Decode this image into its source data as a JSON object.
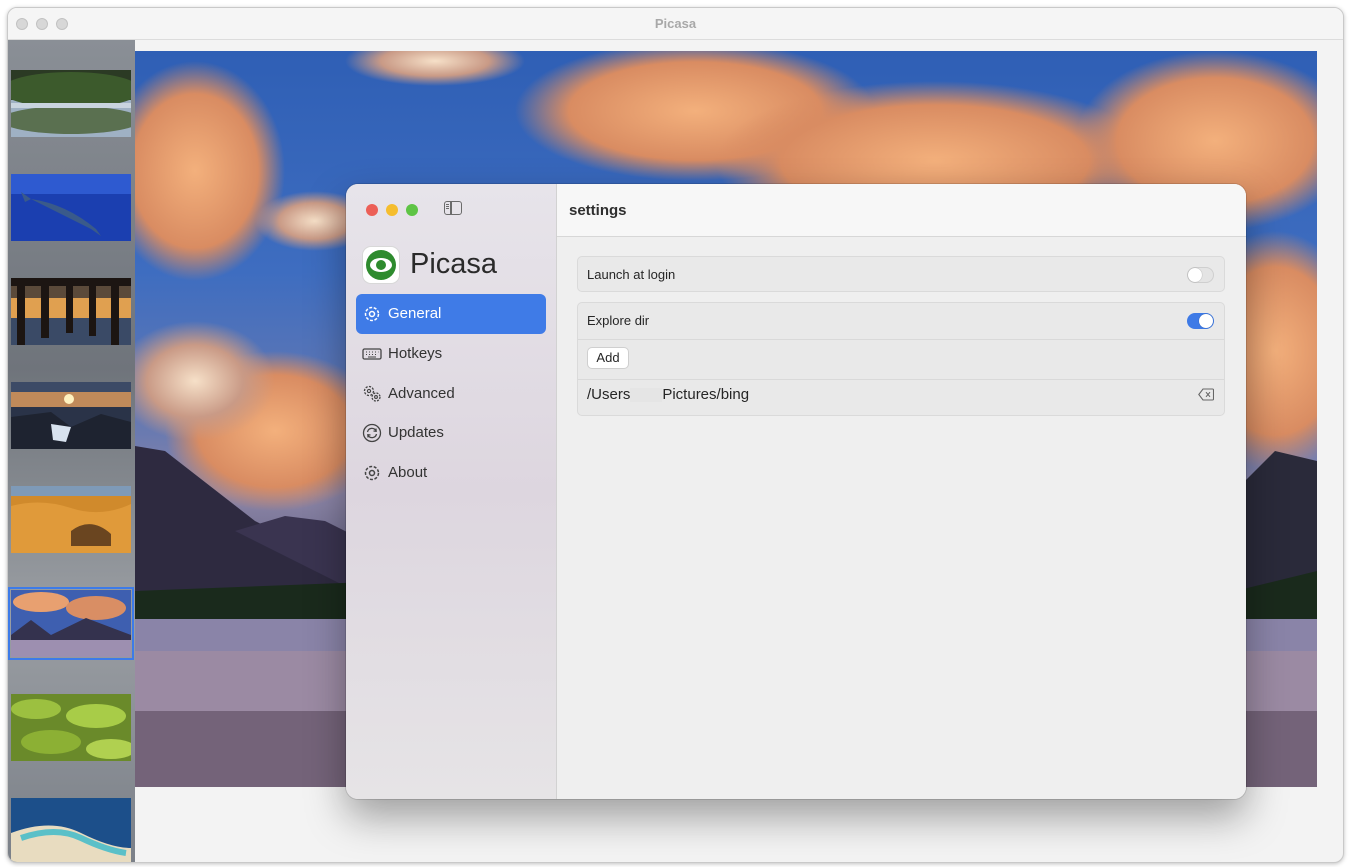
{
  "app": {
    "title": "Picasa"
  },
  "thumbnails": [
    {
      "name": "mangrove-reflection"
    },
    {
      "name": "whale-shark"
    },
    {
      "name": "pier-sunset"
    },
    {
      "name": "rocky-coast-sunset"
    },
    {
      "name": "desert-dunes"
    },
    {
      "name": "mountain-lake-clouds",
      "selected": true
    },
    {
      "name": "green-lily-pads"
    },
    {
      "name": "tropical-atoll"
    }
  ],
  "settings": {
    "brand": "Picasa",
    "header_title": "settings",
    "nav": [
      {
        "label": "General",
        "icon": "gear-icon",
        "active": true
      },
      {
        "label": "Hotkeys",
        "icon": "keyboard-icon"
      },
      {
        "label": "Advanced",
        "icon": "gears-icon"
      },
      {
        "label": "Updates",
        "icon": "refresh-icon"
      },
      {
        "label": "About",
        "icon": "gear-icon"
      }
    ],
    "general": {
      "launch_at_login": {
        "label": "Launch at login",
        "enabled": false
      },
      "explore_dir": {
        "label": "Explore dir",
        "enabled": true
      },
      "add_label": "Add",
      "dir_prefix": "/Users",
      "dir_suffix": "Pictures/bing"
    }
  },
  "colors": {
    "accent": "#3f7be7",
    "traffic_red": "#ec5f57",
    "traffic_yellow": "#f5bd2e",
    "traffic_green": "#5ec445",
    "logo_green": "#2e8b2e"
  }
}
